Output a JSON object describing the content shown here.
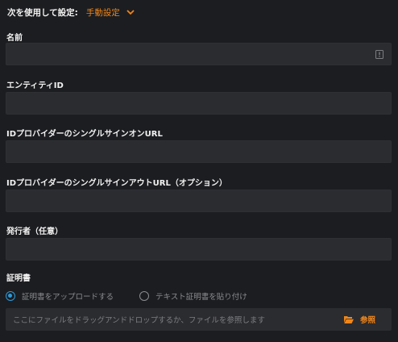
{
  "config": {
    "label": "次を使用して設定:",
    "mode": "手動設定"
  },
  "fields": {
    "name": {
      "label": "名前",
      "value": ""
    },
    "entity_id": {
      "label": "エンティティID",
      "value": ""
    },
    "sso_url": {
      "label": "IDプロバイダーのシングルサインオンURL",
      "value": ""
    },
    "slo_url": {
      "label": "IDプロバイダーのシングルサインアウトURL（オプション）",
      "value": ""
    },
    "issuer": {
      "label": "発行者（任意）",
      "value": ""
    }
  },
  "certificate": {
    "label": "証明書",
    "options": [
      {
        "label": "証明書をアップロードする",
        "selected": true
      },
      {
        "label": "テキスト証明書を貼り付け",
        "selected": false
      }
    ],
    "dropzone_text": "ここにファイルをドラッグアンドドロップするか、ファイルを参照します",
    "browse_label": "参照"
  },
  "colors": {
    "accent": "#f0861a",
    "radio_selected": "#2f9ad8",
    "background": "#1c1d20",
    "input_bg": "#2b2c30"
  },
  "icons": {
    "mode_dropdown": "chevron-down-icon",
    "name_field": "info-icon",
    "browse": "folder-open-icon"
  }
}
